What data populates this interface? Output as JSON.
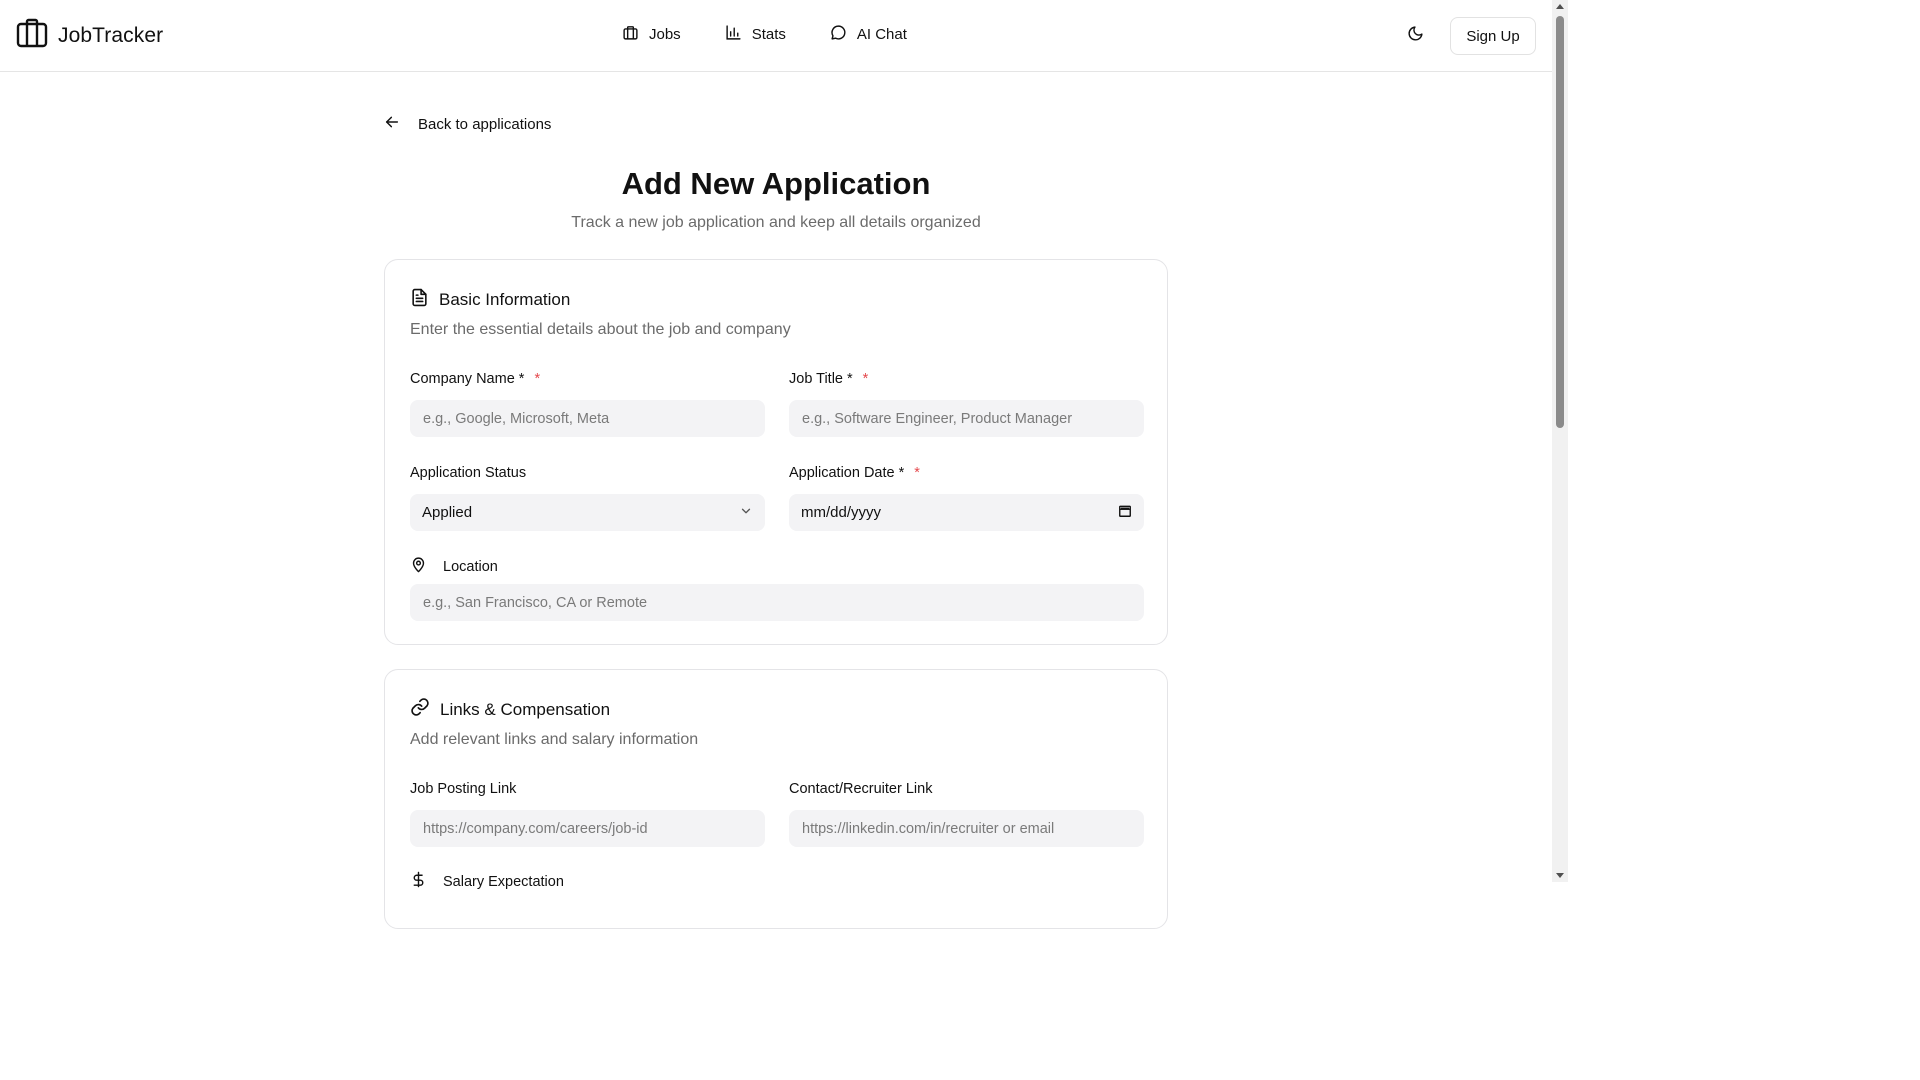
{
  "header": {
    "brand": "JobTracker",
    "nav": [
      {
        "label": "Jobs",
        "icon": "briefcase-icon"
      },
      {
        "label": "Stats",
        "icon": "bar-chart-icon"
      },
      {
        "label": "AI Chat",
        "icon": "chat-bubble-icon"
      }
    ],
    "theme_toggle_icon": "moon-icon",
    "signup_label": "Sign Up"
  },
  "back_link": "Back to applications",
  "page": {
    "title": "Add New Application",
    "subtitle": "Track a new job application and keep all details organized"
  },
  "basic_info": {
    "title": "Basic Information",
    "description": "Enter the essential details about the job and company",
    "company_label": "Company Name *",
    "company_placeholder": "e.g., Google, Microsoft, Meta",
    "job_title_label": "Job Title *",
    "job_title_placeholder": "e.g., Software Engineer, Product Manager",
    "status_label": "Application Status",
    "status_value": "Applied",
    "date_label": "Application Date *",
    "date_value": "mm/dd/yyyy",
    "location_label": "Location",
    "location_placeholder": "e.g., San Francisco, CA or Remote",
    "required_marker": "*"
  },
  "links_comp": {
    "title": "Links & Compensation",
    "description": "Add relevant links and salary information",
    "posting_label": "Job Posting Link",
    "posting_placeholder": "https://company.com/careers/job-id",
    "contact_label": "Contact/Recruiter Link",
    "contact_placeholder": "https://linkedin.com/in/recruiter or email",
    "salary_label": "Salary Expectation"
  },
  "colors": {
    "required": "#e5484d",
    "input_bg": "#f3f3f5",
    "muted_text": "#6b6b6b"
  }
}
